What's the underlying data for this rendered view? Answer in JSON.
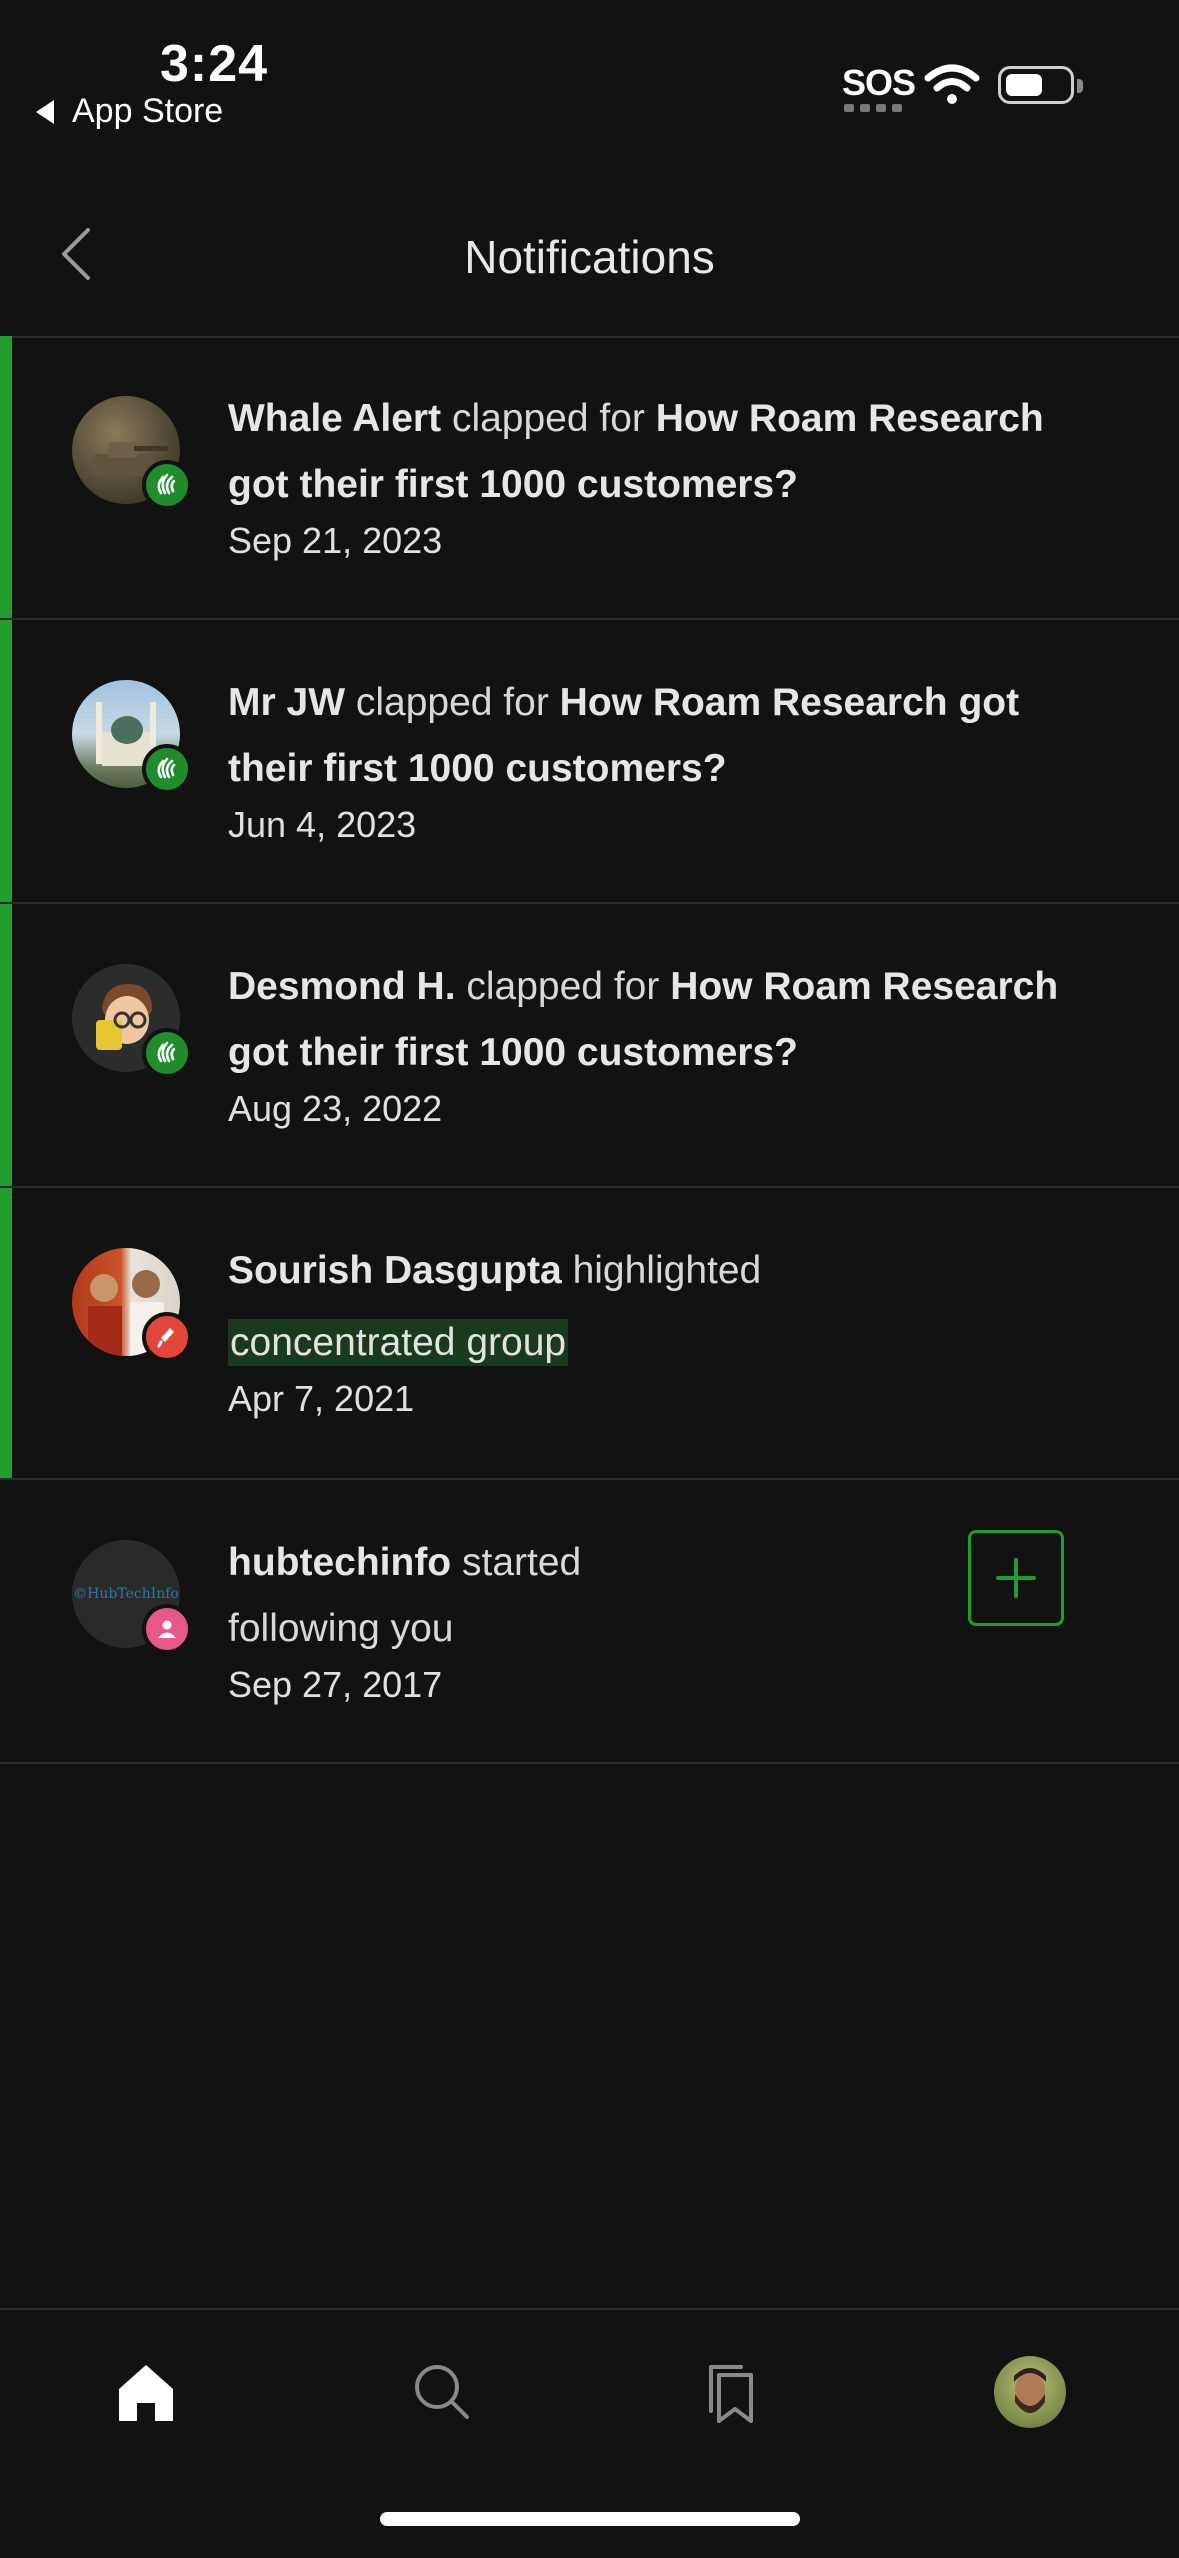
{
  "status_bar": {
    "time": "3:24",
    "back_app_label": "App Store",
    "sos": "SOS"
  },
  "header": {
    "title": "Notifications"
  },
  "notifications": [
    {
      "actor": "Whale Alert",
      "verb": "clapped for",
      "target": "How Roam Research got their first 1000 customers?",
      "date": "Sep 21, 2023",
      "type": "clap",
      "unread": true
    },
    {
      "actor": "Mr JW",
      "verb": "clapped for",
      "target": "How Roam Research got their first 1000 customers?",
      "date": "Jun 4, 2023",
      "type": "clap",
      "unread": true
    },
    {
      "actor": "Desmond H.",
      "verb": "clapped for",
      "target": "How Roam Research got their first 1000 customers?",
      "date": "Aug 23, 2022",
      "type": "clap",
      "unread": true
    },
    {
      "actor": "Sourish Dasgupta",
      "verb": "highlighted",
      "target": "concentrated group",
      "date": "Apr 7, 2021",
      "type": "highlight",
      "unread": true
    },
    {
      "actor": "hubtechinfo",
      "verb": "started",
      "verb2": "following you",
      "date": "Sep 27, 2017",
      "type": "follow",
      "unread": false,
      "avatar_text": "©HubTechInfo"
    }
  ],
  "colors": {
    "background": "#121212",
    "accent_green": "#1f9d2f",
    "highlight_bg": "#193a1e",
    "divider": "#2b2b2b"
  },
  "bottom_nav": {
    "items": [
      "home-icon",
      "search-icon",
      "bookmarks-icon",
      "profile-avatar"
    ]
  }
}
